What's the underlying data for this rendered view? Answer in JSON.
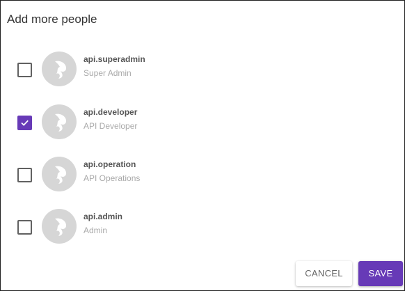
{
  "dialog": {
    "title": "Add more people",
    "accent_color": "#673ab7",
    "people": [
      {
        "name": "api.superadmin",
        "role": "Super Admin",
        "checked": false,
        "avatar_icon": "default-avatar-icon"
      },
      {
        "name": "api.developer",
        "role": "API Developer",
        "checked": true,
        "avatar_icon": "default-avatar-icon"
      },
      {
        "name": "api.operation",
        "role": "API Operations",
        "checked": false,
        "avatar_icon": "default-avatar-icon"
      },
      {
        "name": "api.admin",
        "role": "Admin",
        "checked": false,
        "avatar_icon": "default-avatar-icon"
      }
    ],
    "actions": {
      "cancel_label": "CANCEL",
      "save_label": "SAVE"
    }
  }
}
